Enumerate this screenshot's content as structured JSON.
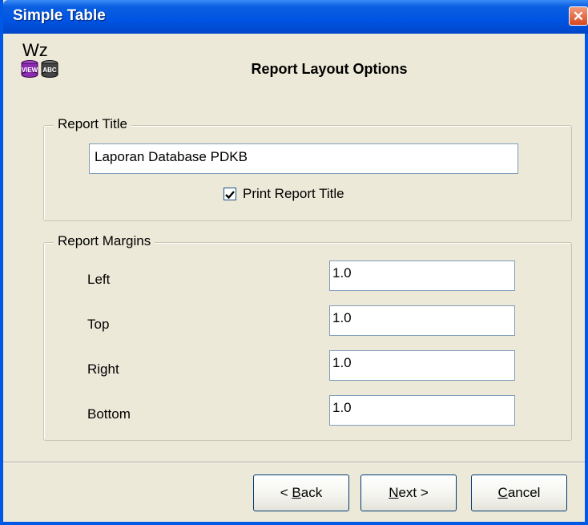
{
  "window": {
    "title": "Simple Table",
    "close_glyph": "✕"
  },
  "header": {
    "logo_text": "Wz",
    "logo_icon_labels": [
      "VIEW",
      "ABC"
    ],
    "title": "Report Layout Options"
  },
  "report_title_group": {
    "label": "Report Title",
    "title_value": "Laporan Database PDKB",
    "print_checkbox_label": "Print Report Title",
    "print_checked": true
  },
  "margins_group": {
    "label": "Report Margins",
    "fields": [
      {
        "label": "Left",
        "value": "1.0"
      },
      {
        "label": "Top",
        "value": "1.0"
      },
      {
        "label": "Right",
        "value": "1.0"
      },
      {
        "label": "Bottom",
        "value": "1.0"
      }
    ]
  },
  "buttons": {
    "back_prefix": "< ",
    "back_accel": "B",
    "back_rest": "ack",
    "next_accel": "N",
    "next_rest": "ext >",
    "cancel_accel": "C",
    "cancel_rest": "ancel"
  },
  "colors": {
    "titlebar": "#0054E3",
    "dialog_bg": "#ECE9D8",
    "close_button": "#D9471E",
    "view_icon": "#8A2BB0",
    "abc_icon": "#444444"
  }
}
